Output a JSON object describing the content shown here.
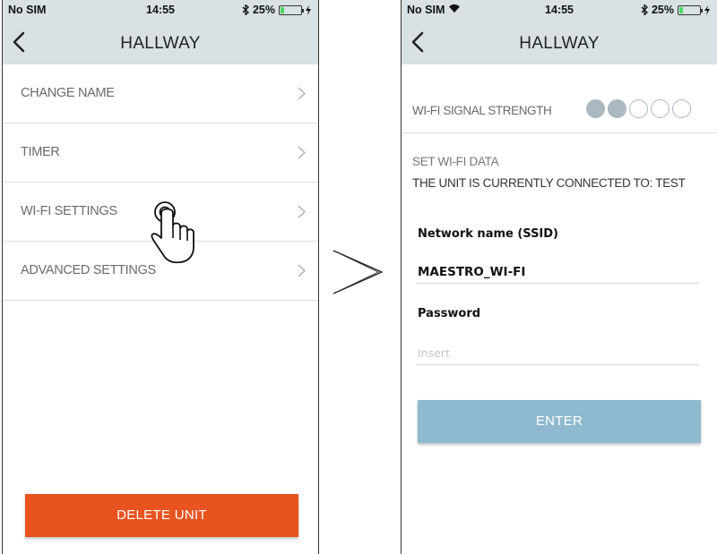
{
  "colors": {
    "header_bg": "#d9e1e4",
    "delete_button": "#e8531f",
    "enter_button": "#8fb9ce",
    "signal_dot": "#aab8bf",
    "battery_green": "#4cd964"
  },
  "left_screen": {
    "status_bar": {
      "carrier": "No SIM",
      "time": "14:55",
      "battery": "25%",
      "battery_fraction": 0.25
    },
    "nav": {
      "back_icon": "chevron-left-icon",
      "title": "HALLWAY"
    },
    "menu": [
      {
        "label": "CHANGE NAME"
      },
      {
        "label": "TIMER"
      },
      {
        "label": "WI-FI SETTINGS"
      },
      {
        "label": "ADVANCED SETTINGS"
      }
    ],
    "delete_button": "DELETE UNIT",
    "pointer_icon": "hand-pointer-icon"
  },
  "transition_icon": "chevron-right-arrow-icon",
  "right_screen": {
    "status_bar": {
      "carrier": "No SIM",
      "time": "14:55",
      "battery": "25%",
      "battery_fraction": 0.25
    },
    "nav": {
      "back_icon": "chevron-left-icon",
      "title": "HALLWAY"
    },
    "signal": {
      "label": "WI-FI SIGNAL STRENGTH",
      "level": 2,
      "max": 5
    },
    "section_title": "SET WI-FI DATA",
    "connected_text": "THE UNIT IS CURRENTLY CONNECTED TO: TEST",
    "ssid": {
      "label": "Network name (SSID)",
      "value": "MAESTRO_WI-FI"
    },
    "password": {
      "label": "Password",
      "placeholder": "Insert",
      "value": ""
    },
    "enter_button": "ENTER"
  }
}
